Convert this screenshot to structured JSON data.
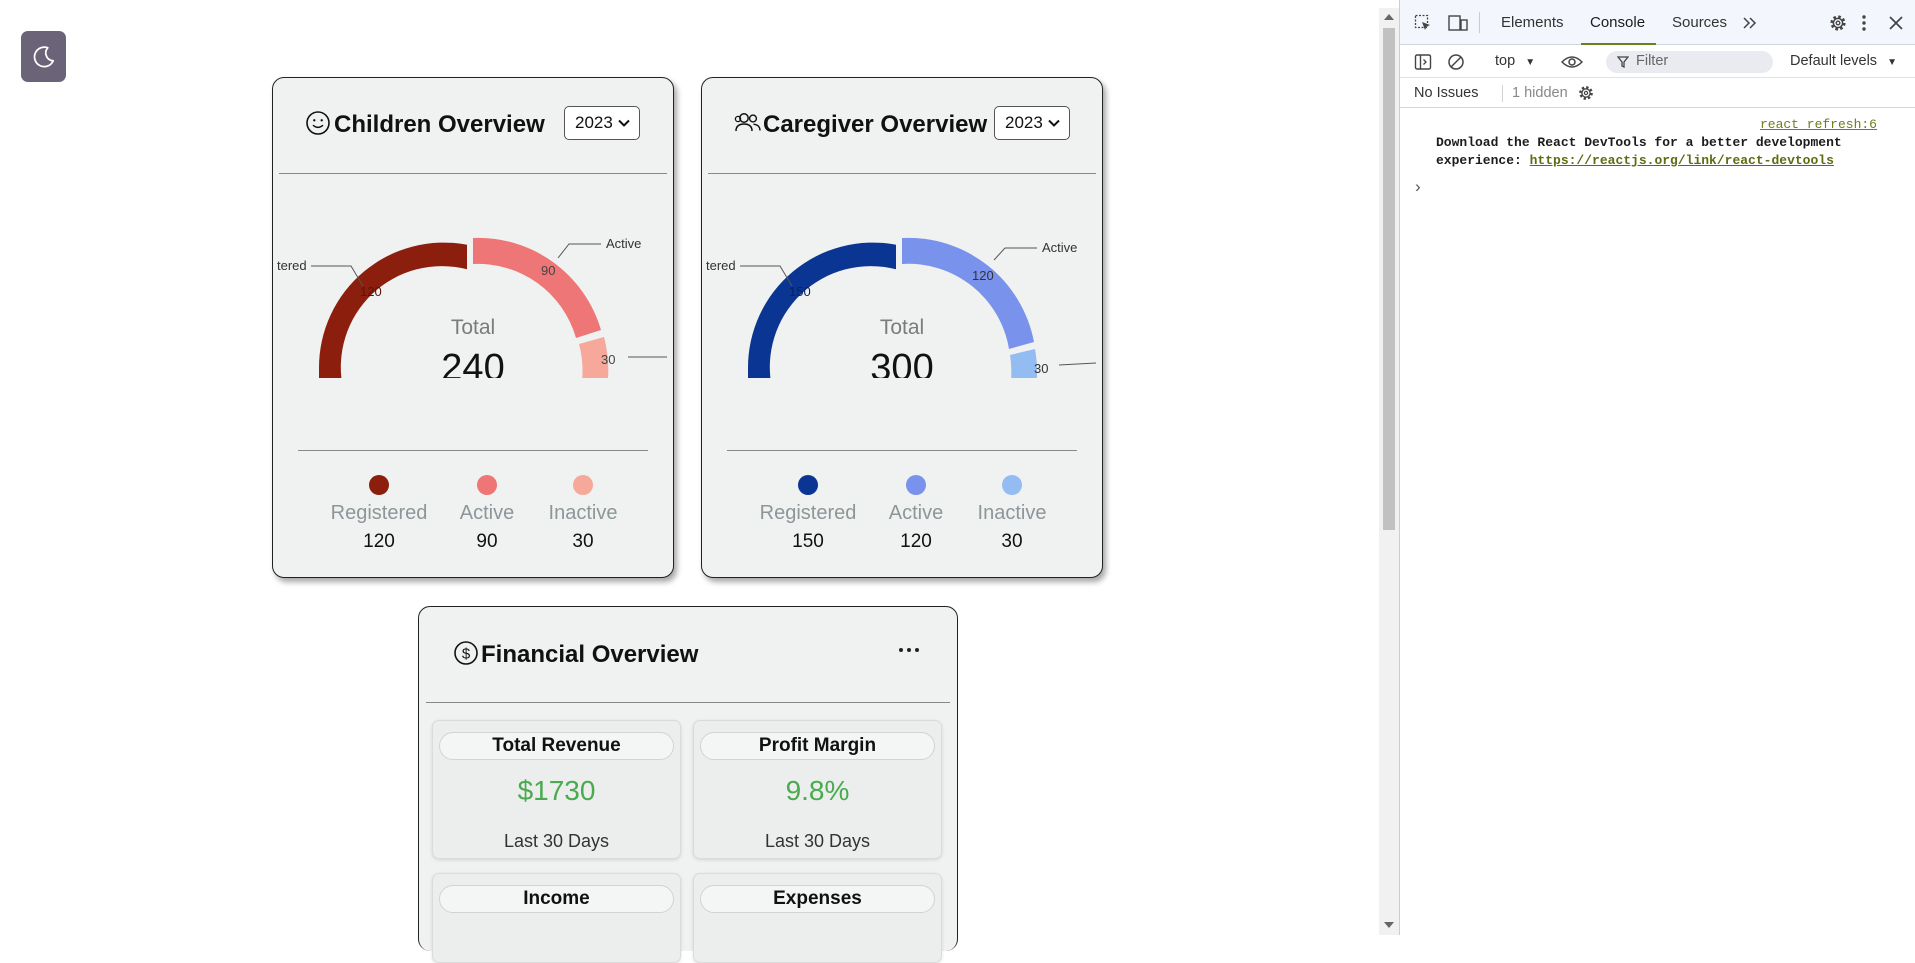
{
  "theme_toggle": {
    "icon": "moon-icon"
  },
  "children_card": {
    "title": "Children Overview",
    "icon": "smiley-icon",
    "year": "2023",
    "total_label": "Total",
    "total_value": "240",
    "segment_labels": {
      "registered_callout": "tered",
      "active_callout": "Active",
      "active_value": "90",
      "inactive_value": "30",
      "registered_value": "120"
    },
    "colors": {
      "registered": "#8b1e0c",
      "active": "#ef7676",
      "inactive": "#f6a89a"
    },
    "legend": [
      {
        "label": "Registered",
        "value": "120"
      },
      {
        "label": "Active",
        "value": "90"
      },
      {
        "label": "Inactive",
        "value": "30"
      }
    ]
  },
  "caregiver_card": {
    "title": "Caregiver Overview",
    "icon": "people-icon",
    "year": "2023",
    "total_label": "Total",
    "total_value": "300",
    "segment_labels": {
      "registered_callout": "tered",
      "active_callout": "Active",
      "active_value": "120",
      "inactive_value": "30",
      "registered_value": "150"
    },
    "colors": {
      "registered": "#0a3592",
      "active": "#7993ec",
      "inactive": "#93bcf3"
    },
    "legend": [
      {
        "label": "Registered",
        "value": "150"
      },
      {
        "label": "Active",
        "value": "120"
      },
      {
        "label": "Inactive",
        "value": "30"
      }
    ]
  },
  "financial_card": {
    "title": "Financial Overview",
    "icon": "dollar-circle-icon",
    "menu_icon": "ellipsis-icon",
    "boxes": [
      {
        "title": "Total Revenue",
        "value": "$1730",
        "sub": "Last 30 Days"
      },
      {
        "title": "Profit Margin",
        "value": "9.8%",
        "sub": "Last 30 Days"
      },
      {
        "title": "Income",
        "value": "",
        "sub": ""
      },
      {
        "title": "Expenses",
        "value": "",
        "sub": ""
      }
    ],
    "value_color": "#4aaa4e"
  },
  "devtools": {
    "tabs": [
      "Elements",
      "Console",
      "Sources"
    ],
    "active_tab": "Console",
    "context": "top",
    "filter_placeholder": "Filter",
    "levels": "Default levels",
    "issues": "No Issues",
    "hidden": "1 hidden",
    "console": {
      "source_link": "react_refresh:6",
      "message_line1": "Download the React DevTools for a better development",
      "message_line2_prefix": "experience: ",
      "message_link": "https://reactjs.org/link/react-devtools",
      "prompt": "›"
    }
  }
}
